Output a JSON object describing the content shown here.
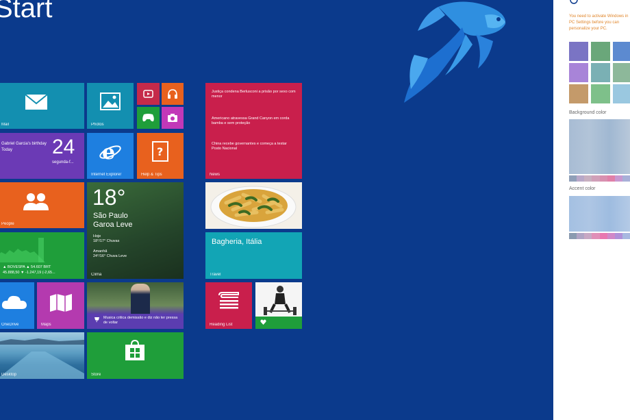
{
  "start": {
    "title": "Start"
  },
  "tiles": {
    "mail": "Mail",
    "photos": "Photos",
    "calendar": {
      "event": "Gabriel Garcia's birthday",
      "sub": "Today",
      "day": "24",
      "weekday": "segunda-f..."
    },
    "ie": "Internet Explorer",
    "help": "Help & Tips",
    "people": "People",
    "weather": {
      "temp": "18°",
      "city": "São Paulo",
      "desc": "Garoa Leve",
      "today_label": "Hoje",
      "today_text": "18°/17° Chuvas",
      "tomorrow_label": "Amanhã",
      "tomorrow_text": "24°/16° Chuva Leve",
      "label": "Clima"
    },
    "finance": {
      "line1": "▲ BOVESPA  ▲ 54.607 BRT",
      "line2": "45.888,50 ▼ -1.247,19 (-2,65..."
    },
    "onedrive": "OneDrive",
    "maps": "Maps",
    "music_news": "Musica critica demissão e diz não ter pressa de voltar",
    "desktop": "Desktop",
    "store": "Store",
    "news": {
      "headlines": [
        "Justiça condena Berlusconi a prisão por sexo com menor",
        "Americano atravessa Grand Canyon em corda bamba e sem proteção",
        "China recebe governantes e começa a testar Posto Nacional"
      ],
      "label": "News"
    },
    "travel": {
      "place": "Bagheria, Itália",
      "label": "Travel"
    },
    "reading": "Reading List"
  },
  "panel": {
    "warning": "You need to activate Windows in PC Settings before you can personalize your PC.",
    "background_label": "Background color",
    "accent_label": "Accent color"
  }
}
